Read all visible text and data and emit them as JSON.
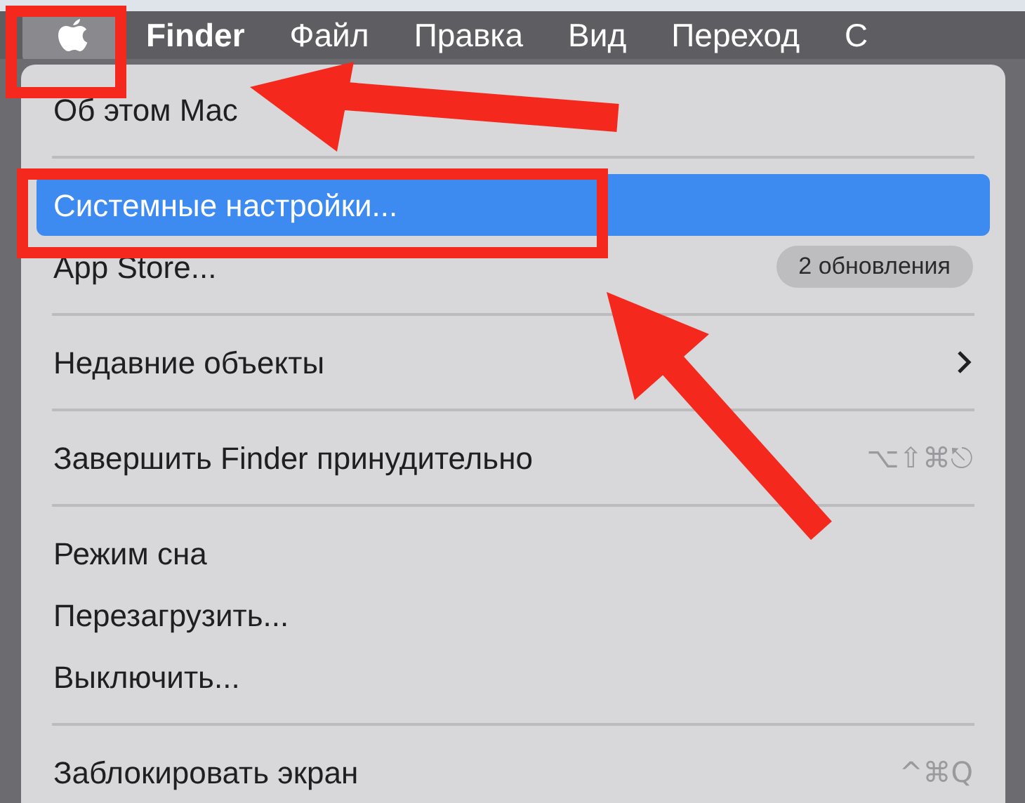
{
  "menu_bar": [
    {
      "kind": "apple",
      "selected": true
    },
    {
      "kind": "text",
      "label": "Finder",
      "bold": true,
      "selected": false
    },
    {
      "kind": "text",
      "label": "Файл",
      "bold": false,
      "selected": false
    },
    {
      "kind": "text",
      "label": "Правка",
      "bold": false,
      "selected": false
    },
    {
      "kind": "text",
      "label": "Вид",
      "bold": false,
      "selected": false
    },
    {
      "kind": "text",
      "label": "Переход",
      "bold": false,
      "selected": false
    },
    {
      "kind": "text",
      "label": "С",
      "bold": false,
      "selected": false
    }
  ],
  "menu": {
    "groups": [
      [
        {
          "label": "Об этом Mac",
          "selected": false
        }
      ],
      [
        {
          "label": "Системные настройки...",
          "selected": true
        },
        {
          "label": "App Store...",
          "selected": false,
          "badge": "2 обновления"
        }
      ],
      [
        {
          "label": "Недавние объекты",
          "selected": false,
          "submenu": true
        }
      ],
      [
        {
          "label": "Завершить Finder принудительно",
          "selected": false,
          "shortcut": "⌥⇧⌘⎋"
        }
      ],
      [
        {
          "label": "Режим сна",
          "selected": false
        },
        {
          "label": "Перезагрузить...",
          "selected": false
        },
        {
          "label": "Выключить...",
          "selected": false
        }
      ],
      [
        {
          "label": "Заблокировать экран",
          "selected": false,
          "shortcut": "^⌘Q"
        }
      ]
    ]
  }
}
